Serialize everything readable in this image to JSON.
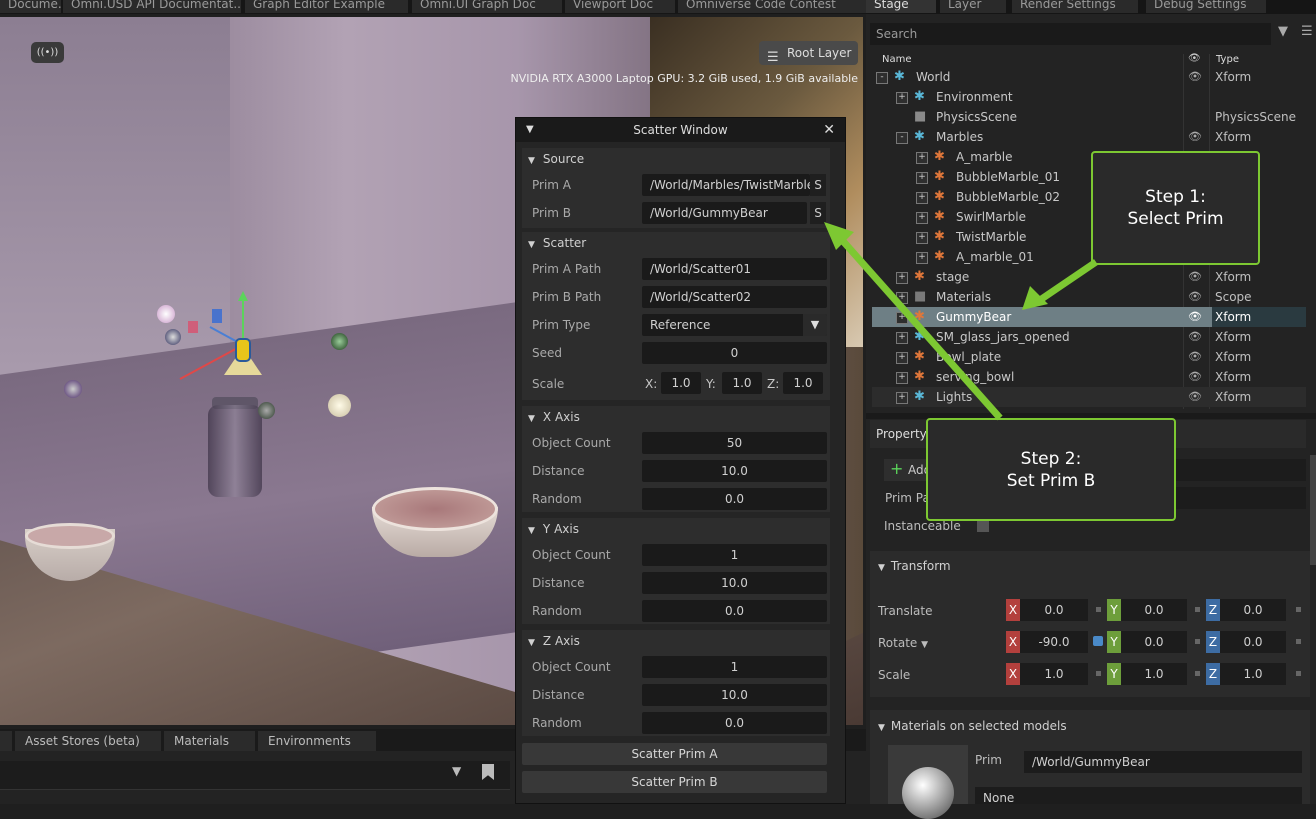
{
  "top_tabs": [
    "Docume...",
    "Omni.USD API Documentat...",
    "Graph Editor Example",
    "Omni.UI Graph Doc",
    "Viewport Doc",
    "Omniverse Code Contest"
  ],
  "viewport": {
    "root_layer_label": "Root Layer",
    "gpu_info": "NVIDIA RTX A3000 Laptop GPU: 3.2 GiB used,  1.9 GiB available"
  },
  "bottom_tabs": [
    "Asset Stores (beta)",
    "Materials",
    "Environments"
  ],
  "scatter_window": {
    "title": "Scatter Window",
    "source": {
      "header": "Source",
      "prim_a_label": "Prim A",
      "prim_a_value": "/World/Marbles/TwistMarble",
      "prim_b_label": "Prim B",
      "prim_b_value": "/World/GummyBear",
      "s_button": "S"
    },
    "scatter": {
      "header": "Scatter",
      "prim_a_path_label": "Prim A Path",
      "prim_a_path_value": "/World/Scatter01",
      "prim_b_path_label": "Prim B Path",
      "prim_b_path_value": "/World/Scatter02",
      "prim_type_label": "Prim Type",
      "prim_type_value": "Reference",
      "seed_label": "Seed",
      "seed_value": "0",
      "scale_label": "Scale",
      "x_label": "X:",
      "y_label": "Y:",
      "z_label": "Z:",
      "scale_x": "1.0",
      "scale_y": "1.0",
      "scale_z": "1.0"
    },
    "x_axis": {
      "header": "X Axis",
      "count_label": "Object Count",
      "count": "50",
      "distance_label": "Distance",
      "distance": "10.0",
      "random_label": "Random",
      "random": "0.0"
    },
    "y_axis": {
      "header": "Y Axis",
      "count_label": "Object Count",
      "count": "1",
      "distance_label": "Distance",
      "distance": "10.0",
      "random_label": "Random",
      "random": "0.0"
    },
    "z_axis": {
      "header": "Z Axis",
      "count_label": "Object Count",
      "count": "1",
      "distance_label": "Distance",
      "distance": "10.0",
      "random_label": "Random",
      "random": "0.0"
    },
    "scatter_a_button": "Scatter Prim A",
    "scatter_b_button": "Scatter Prim B"
  },
  "stage": {
    "tabs": [
      "Stage",
      "Layer",
      "Render Settings",
      "Debug Settings"
    ],
    "search_placeholder": "Search",
    "col_name": "Name",
    "col_type": "Type",
    "rows": [
      {
        "name": "World",
        "type": "Xform",
        "eye": true
      },
      {
        "name": "Environment",
        "type": "",
        "eye": false
      },
      {
        "name": "PhysicsScene",
        "type": "PhysicsScene",
        "eye": false
      },
      {
        "name": "Marbles",
        "type": "Xform",
        "eye": true
      },
      {
        "name": "A_marble",
        "type": "",
        "eye": false
      },
      {
        "name": "BubbleMarble_01",
        "type": "",
        "eye": false
      },
      {
        "name": "BubbleMarble_02",
        "type": "",
        "eye": false
      },
      {
        "name": "SwirlMarble",
        "type": "",
        "eye": false
      },
      {
        "name": "TwistMarble",
        "type": "",
        "eye": false
      },
      {
        "name": "A_marble_01",
        "type": "",
        "eye": false
      },
      {
        "name": "stage",
        "type": "Xform",
        "eye": true
      },
      {
        "name": "Materials",
        "type": "Scope",
        "eye": true
      },
      {
        "name": "GummyBear",
        "type": "Xform",
        "eye": true
      },
      {
        "name": "SM_glass_jars_opened",
        "type": "Xform",
        "eye": true
      },
      {
        "name": "Bowl_plate",
        "type": "Xform",
        "eye": true
      },
      {
        "name": "serving_bowl",
        "type": "Xform",
        "eye": true
      },
      {
        "name": "Lights",
        "type": "Xform",
        "eye": true
      }
    ]
  },
  "property": {
    "tab": "Property",
    "add_label": "Add",
    "prim_path_label": "Prim Pa",
    "instanceable_label": "Instanceable",
    "transform_header": "Transform",
    "translate_label": "Translate",
    "translate": [
      "0.0",
      "0.0",
      "0.0"
    ],
    "rotate_label": "Rotate",
    "rotate": [
      "-90.0",
      "0.0",
      "0.0"
    ],
    "scale_label": "Scale",
    "scale": [
      "1.0",
      "1.0",
      "1.0"
    ],
    "axis_x": "X",
    "axis_y": "Y",
    "axis_z": "Z",
    "materials_header": "Materials on selected models",
    "prim_label": "Prim",
    "prim_value": "/World/GummyBear",
    "none_label": "None"
  },
  "callouts": {
    "step1_line1": "Step 1:",
    "step1_line2": "Select Prim",
    "step2_line1": "Step 2:",
    "step2_line2": "Set Prim B"
  },
  "colors": {
    "callout_border": "#7dc832",
    "selection": "#6e7f85"
  }
}
